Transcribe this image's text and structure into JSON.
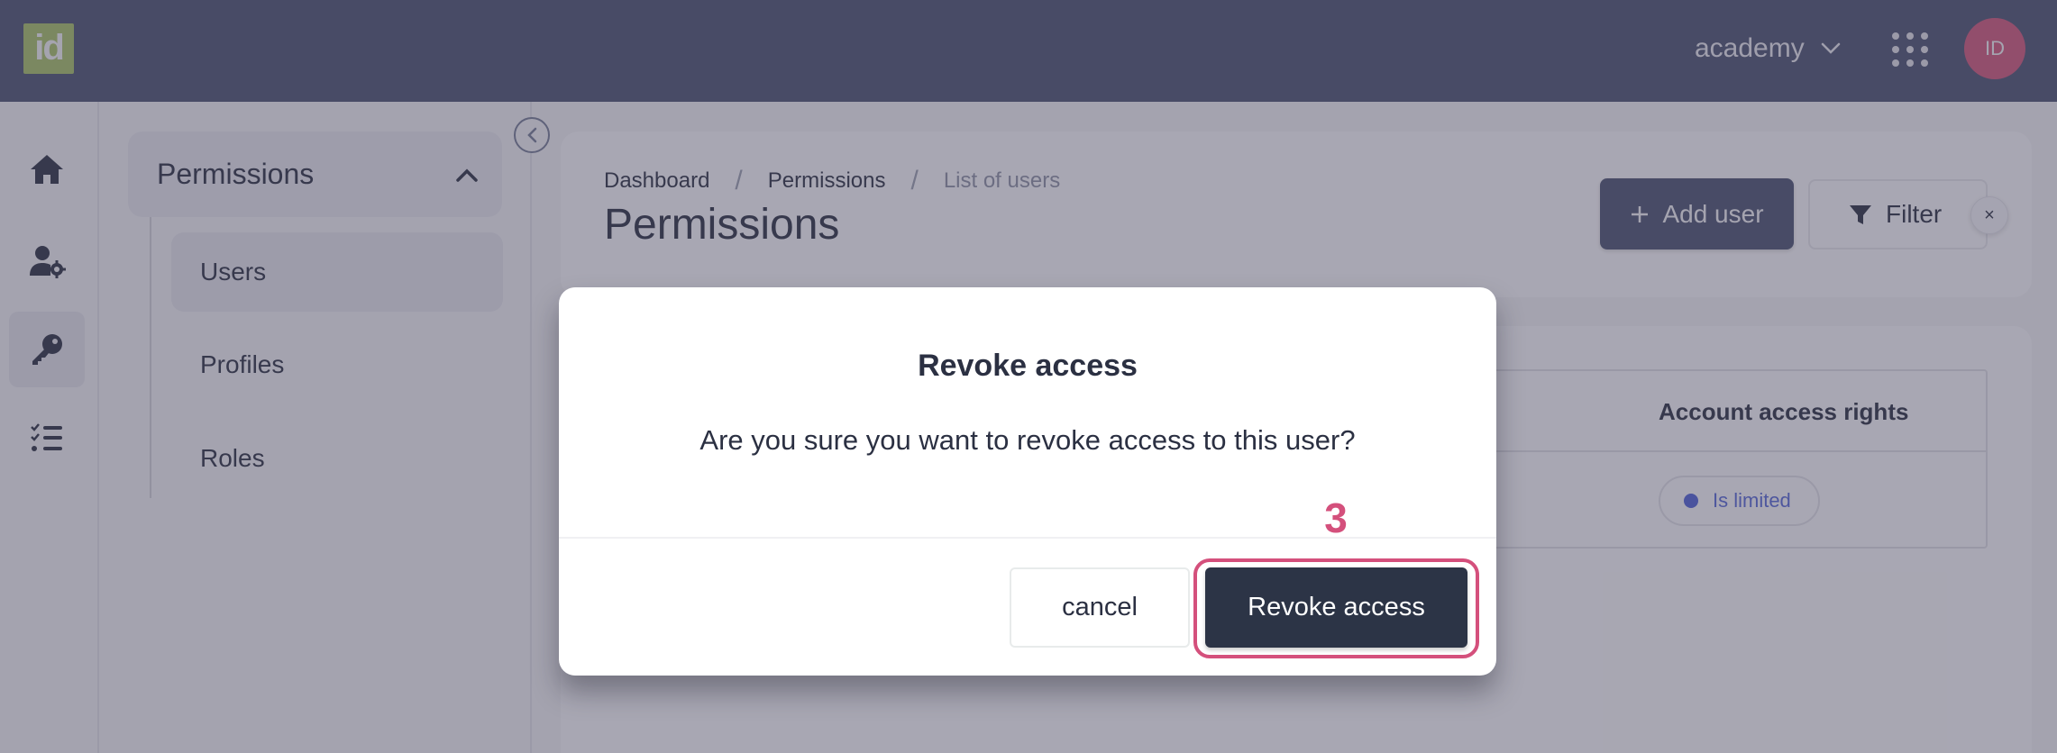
{
  "header": {
    "logo_text": "id",
    "account_name": "academy",
    "avatar_initials": "ID"
  },
  "rail": {
    "items": [
      {
        "name": "home",
        "icon": "home-icon"
      },
      {
        "name": "user-settings",
        "icon": "user-gear-icon"
      },
      {
        "name": "permissions",
        "icon": "key-icon",
        "active": true
      },
      {
        "name": "tasks",
        "icon": "checklist-icon"
      }
    ]
  },
  "submenu": {
    "title": "Permissions",
    "items": [
      {
        "label": "Users",
        "active": true
      },
      {
        "label": "Profiles"
      },
      {
        "label": "Roles"
      }
    ]
  },
  "main": {
    "breadcrumb": [
      "Dashboard",
      "Permissions",
      "List of users"
    ],
    "breadcrumb_separator": "/",
    "title": "Permissions",
    "add_user_label": "Add user",
    "filter_label": "Filter",
    "close_filter_label": "×",
    "table": {
      "columns": [
        "Account access rights"
      ],
      "rows": [
        {
          "account_access_rights": "Is limited"
        }
      ]
    }
  },
  "modal": {
    "title": "Revoke access",
    "message": "Are you sure you want to revoke access to this user?",
    "cancel_label": "cancel",
    "confirm_label": "Revoke access"
  },
  "annotation": {
    "step_number": "3",
    "color": "#d4507c"
  },
  "colors": {
    "header_bg": "#4a5170",
    "logo_bg": "#a6bf66",
    "avatar_bg": "#d0577a",
    "primary_button": "#2c3446",
    "badge_text": "#5566d6"
  }
}
